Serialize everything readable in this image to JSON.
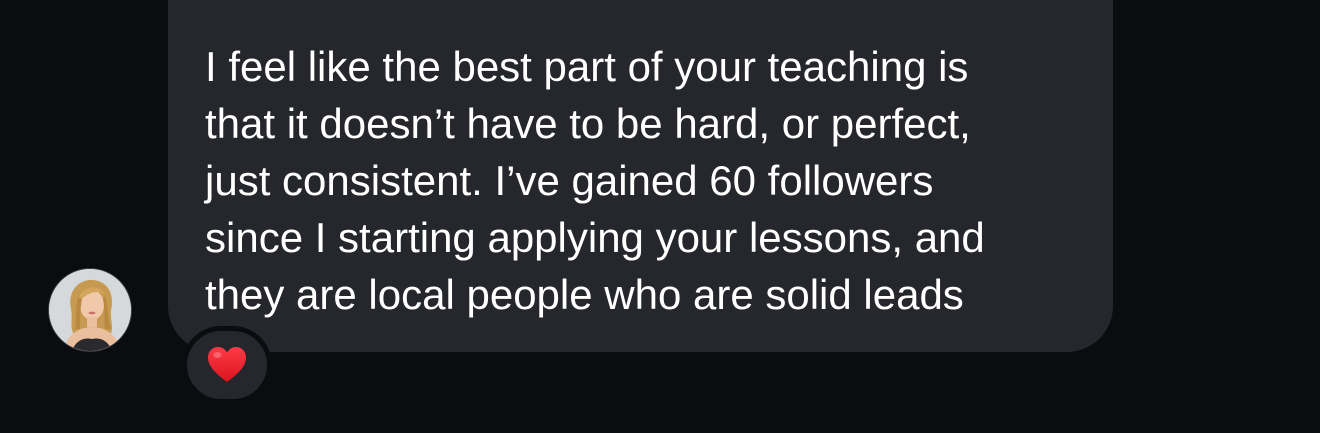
{
  "message": {
    "text": "I feel like the best part of your teaching is\nthat it doesn’t have to be hard, or perfect,\njust consistent. I’ve gained 60 followers\nsince I starting applying your lessons, and\nthey are local people who are solid leads"
  },
  "reaction": {
    "emoji": "heart-icon",
    "color": "#e8212e"
  },
  "avatar": {
    "icon": "profile-photo"
  },
  "colors": {
    "background": "#0b0c10",
    "bubble": "#25272d",
    "text": "#ffffff"
  }
}
